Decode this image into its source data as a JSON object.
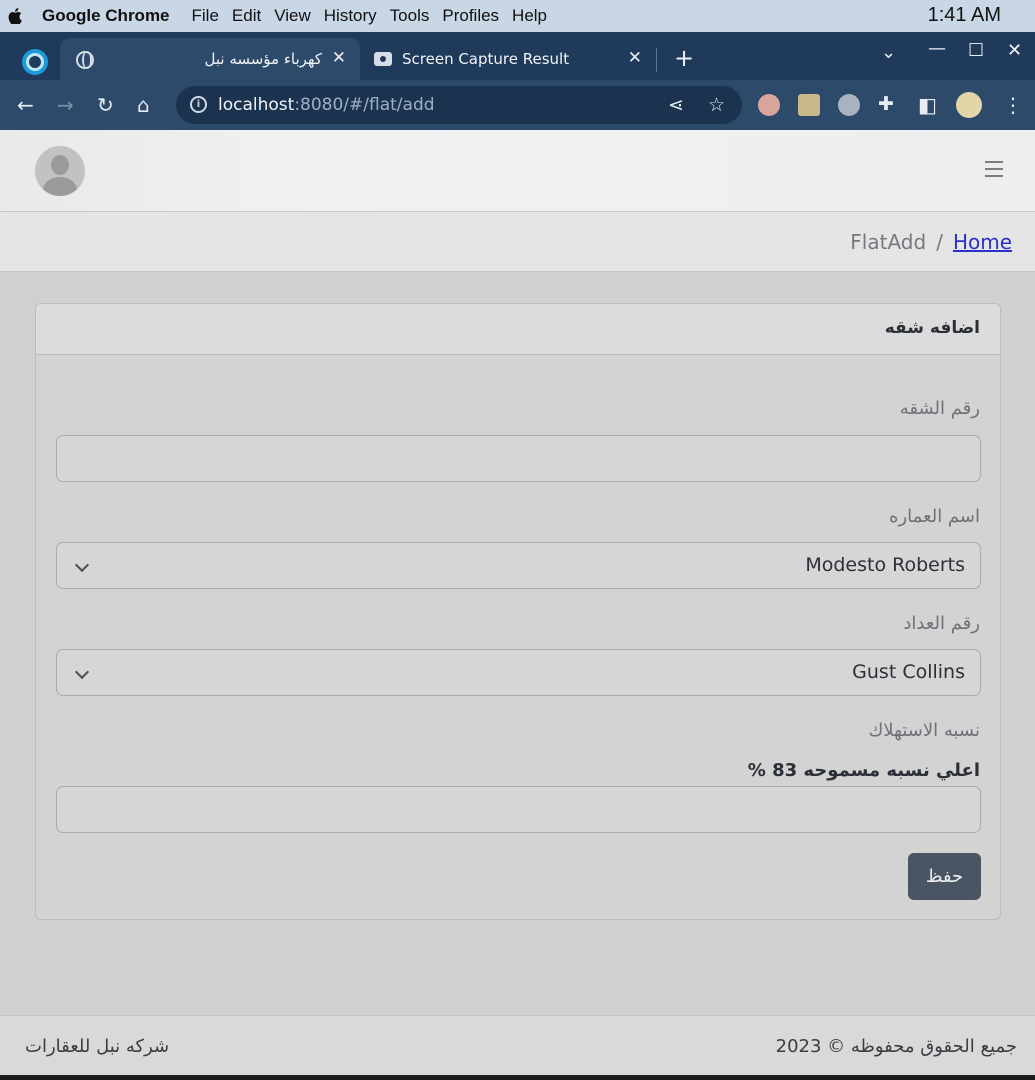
{
  "menubar": {
    "app_name": "Google Chrome",
    "items": [
      "File",
      "Edit",
      "View",
      "History",
      "Tools",
      "Profiles",
      "Help"
    ],
    "clock": "1:41 AM"
  },
  "browser": {
    "tabs": [
      {
        "title": "كهرباء مؤسسه نبل",
        "icon": "globe-icon",
        "active": true
      },
      {
        "title": "Screen Capture Result",
        "icon": "camera-icon",
        "active": false
      }
    ],
    "url_host": "localhost",
    "url_rest": ":8080/#/flat/add"
  },
  "breadcrumb": {
    "current": "FlatAdd",
    "separator": "/",
    "home": "Home"
  },
  "form": {
    "title": "اضافه شقه",
    "flat_number_label": "رقم الشقه",
    "flat_number_value": "",
    "building_label": "اسم العماره",
    "building_value": "Modesto Roberts",
    "meter_label": "رقم العداد",
    "meter_value": "Gust Collins",
    "consumption_label": "نسبه الاستهلاك",
    "max_rate_hint": "اعلي نسبه مسموحه 83 %",
    "consumption_value": "",
    "save_label": "حفظ"
  },
  "footer": {
    "rights": "جميع الحقوق محفوظه © 2023",
    "company": "شركه نبل للعقارات"
  },
  "colors": {
    "save_button": "#4a5563",
    "link": "#2d2fc7",
    "chrome_frame": "#1f3a5a"
  }
}
